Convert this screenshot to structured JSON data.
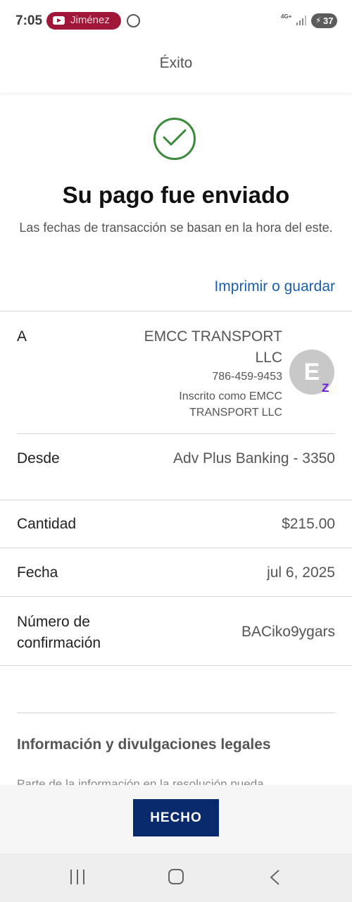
{
  "status_bar": {
    "time": "7:05",
    "notification_app": "Jiménez",
    "network": "4G+",
    "battery": "37"
  },
  "header": {
    "title": "Éxito"
  },
  "confirmation": {
    "title": "Su pago fue enviado",
    "subtitle": "Las fechas de transacción se basan en la hora del este.",
    "print_link": "Imprimir o guardar"
  },
  "recipient": {
    "label": "A",
    "name": "EMCC TRANSPORT LLC",
    "phone": "786-459-9453",
    "enrolled_as": "Inscrito como EMCC TRANSPORT LLC",
    "avatar_initial": "E",
    "badge": "Z"
  },
  "details": {
    "from_label": "Desde",
    "from_value": "Adv Plus Banking - 3350",
    "amount_label": "Cantidad",
    "amount_value": "$215.00",
    "date_label": "Fecha",
    "date_value": "jul 6, 2025",
    "confirmation_label": "Número de confirmación",
    "confirmation_value": "BACiko9ygars"
  },
  "legal": {
    "title": "Información y divulgaciones legales",
    "text": "Parte de la información en la resolución pueda..."
  },
  "footer": {
    "done_label": "HECHO"
  },
  "colors": {
    "accent": "#0a2a6e",
    "link": "#1b5fa8",
    "success": "#3b8a3b",
    "notification": "#a01739",
    "zelle": "#6d1ed4"
  }
}
